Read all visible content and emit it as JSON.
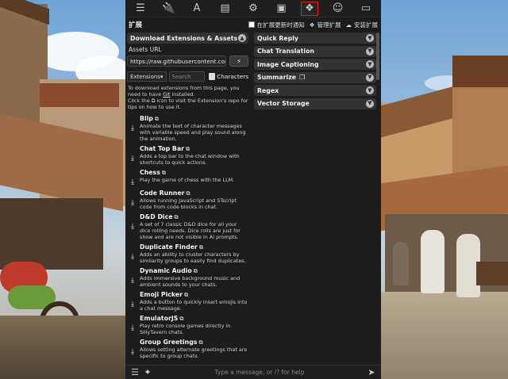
{
  "topbar": {
    "icons": [
      "sliders-icon",
      "plug-icon",
      "text-icon",
      "book-icon",
      "users-gear-icon",
      "image-icon",
      "cubes-icon",
      "face-icon",
      "id-card-icon"
    ],
    "glyphs": [
      "☰",
      "🔌",
      "A",
      "▤",
      "⚙",
      "▣",
      "❖",
      "☺",
      "▭"
    ],
    "active_index": 6
  },
  "header": {
    "title": "扩展",
    "notify_label": "在扩展更新时通知",
    "manage_label": "管理扩展",
    "install_label": "安装扩展"
  },
  "left": {
    "drawer_title": "Download Extensions & Assets",
    "assets_label": "Assets URL",
    "assets_url": "https://raw.githubusercontent.com",
    "filter_select": "Extensions",
    "search_placeholder": "Search",
    "characters_label": "Characters",
    "note_1": "To download extensions from this page, you need to have ",
    "note_git": "Git",
    "note_2": " installed.",
    "note_3": "Click the ",
    "note_4": " icon to visit the Extension's repo for tips on how to use it.",
    "extensions": [
      {
        "name": "Blip",
        "desc": "Animate the text of character messages with variable speed and play sound along the animation."
      },
      {
        "name": "Chat Top Bar",
        "desc": "Adds a top bar to the chat window with shortcuts to quick actions."
      },
      {
        "name": "Chess",
        "desc": "Play the game of chess with the LLM."
      },
      {
        "name": "Code Runner",
        "desc": "Allows running JavaScript and STscript code from code blocks in chat."
      },
      {
        "name": "D&D Dice",
        "desc": "A set of 7 classic D&D dice for all your dice rolling needs. Dice rolls are just for show and are not visible in AI prompts."
      },
      {
        "name": "Duplicate Finder",
        "desc": "Adds an ability to cluster characters by similarity groups to easily find duplicates."
      },
      {
        "name": "Dynamic Audio",
        "desc": "Adds immersive background music and ambient sounds to your chats."
      },
      {
        "name": "Emoji Picker",
        "desc": "Adds a button to quickly insert emojis into a chat message."
      },
      {
        "name": "EmulatorJS",
        "desc": "Play retro console games directly in SillyTavern chats."
      },
      {
        "name": "Group Greetings",
        "desc": "Allows setting alternate greetings that are specific to group chats."
      }
    ]
  },
  "right": {
    "drawers": [
      "Quick Reply",
      "Chat Translation",
      "Image Captioning",
      "Summarize",
      "Regex",
      "Vector Storage"
    ]
  },
  "bottom": {
    "placeholder": "Type a message, or /? for help"
  }
}
